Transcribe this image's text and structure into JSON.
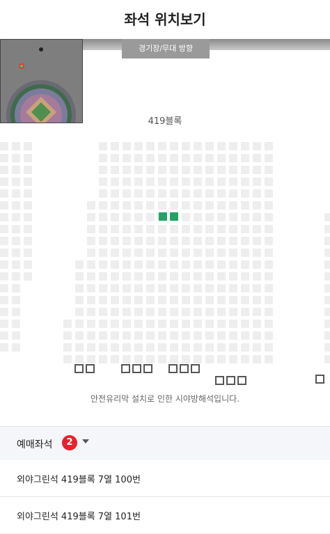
{
  "header": {
    "title": "좌석 위치보기"
  },
  "stadium": {
    "direction_label": "경기장/무대 방향"
  },
  "block": {
    "name": "419블록"
  },
  "notice": "안전유리막 설치로 인한 시야방해석입니다.",
  "reservation": {
    "label": "예매좌석",
    "count": "2",
    "seats": [
      "외야그린석 419블록 7열 100번",
      "외야그린석 419블록 7열 101번"
    ]
  },
  "colors": {
    "selected_seat": "#1fa463",
    "empty_seat": "#eeeeee",
    "badge": "#e8222c"
  }
}
